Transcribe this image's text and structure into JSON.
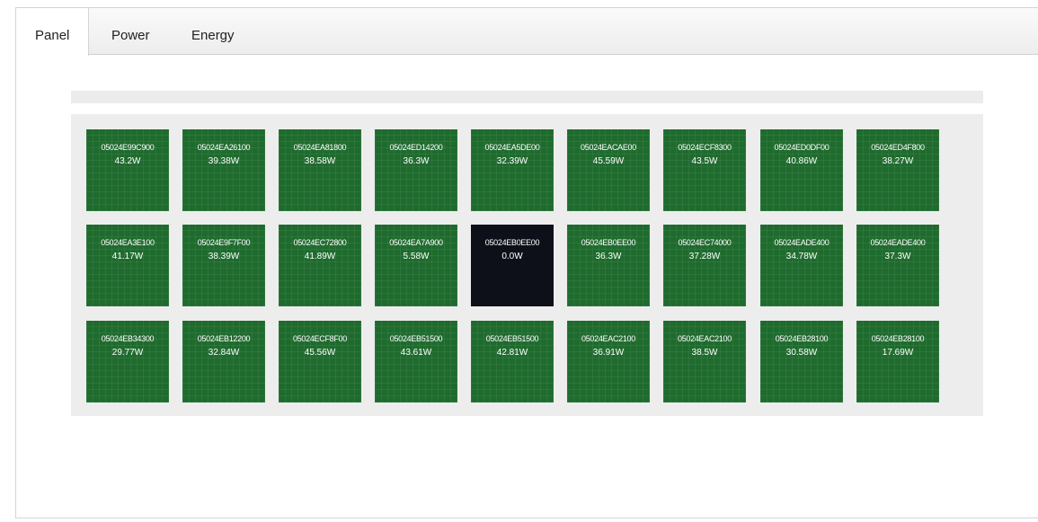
{
  "tabs": [
    {
      "label": "Panel",
      "active": true
    },
    {
      "label": "Power",
      "active": false
    },
    {
      "label": "Energy",
      "active": false
    }
  ],
  "colors": {
    "panel_ok": "#1f6b2e",
    "panel_offline": "#0d1018"
  },
  "panels": [
    [
      {
        "id": "05024E99C900",
        "power": "43.2W"
      },
      {
        "id": "05024EA26100",
        "power": "39.38W"
      },
      {
        "id": "05024EA81800",
        "power": "38.58W"
      },
      {
        "id": "05024ED14200",
        "power": "36.3W"
      },
      {
        "id": "05024EA5DE00",
        "power": "32.39W"
      },
      {
        "id": "05024EACAE00",
        "power": "45.59W"
      },
      {
        "id": "05024ECF8300",
        "power": "43.5W"
      },
      {
        "id": "05024ED0DF00",
        "power": "40.86W"
      },
      {
        "id": "05024ED4F800",
        "power": "38.27W"
      }
    ],
    [
      {
        "id": "05024EA3E100",
        "power": "41.17W"
      },
      {
        "id": "05024E9F7F00",
        "power": "38.39W"
      },
      {
        "id": "05024EC72800",
        "power": "41.89W"
      },
      {
        "id": "05024EA7A900",
        "power": "5.58W"
      },
      {
        "id": "05024EB0EE00",
        "power": "0.0W",
        "offline": true
      },
      {
        "id": "05024EB0EE00",
        "power": "36.3W"
      },
      {
        "id": "05024EC74000",
        "power": "37.28W"
      },
      {
        "id": "05024EADE400",
        "power": "34.78W"
      },
      {
        "id": "05024EADE400",
        "power": "37.3W"
      }
    ],
    [
      {
        "id": "05024EB34300",
        "power": "29.77W"
      },
      {
        "id": "05024EB12200",
        "power": "32.84W"
      },
      {
        "id": "05024ECF8F00",
        "power": "45.56W"
      },
      {
        "id": "05024EB51500",
        "power": "43.61W"
      },
      {
        "id": "05024EB51500",
        "power": "42.81W"
      },
      {
        "id": "05024EAC2100",
        "power": "36.91W"
      },
      {
        "id": "05024EAC2100",
        "power": "38.5W"
      },
      {
        "id": "05024EB28100",
        "power": "30.58W"
      },
      {
        "id": "05024EB28100",
        "power": "17.69W"
      }
    ]
  ]
}
